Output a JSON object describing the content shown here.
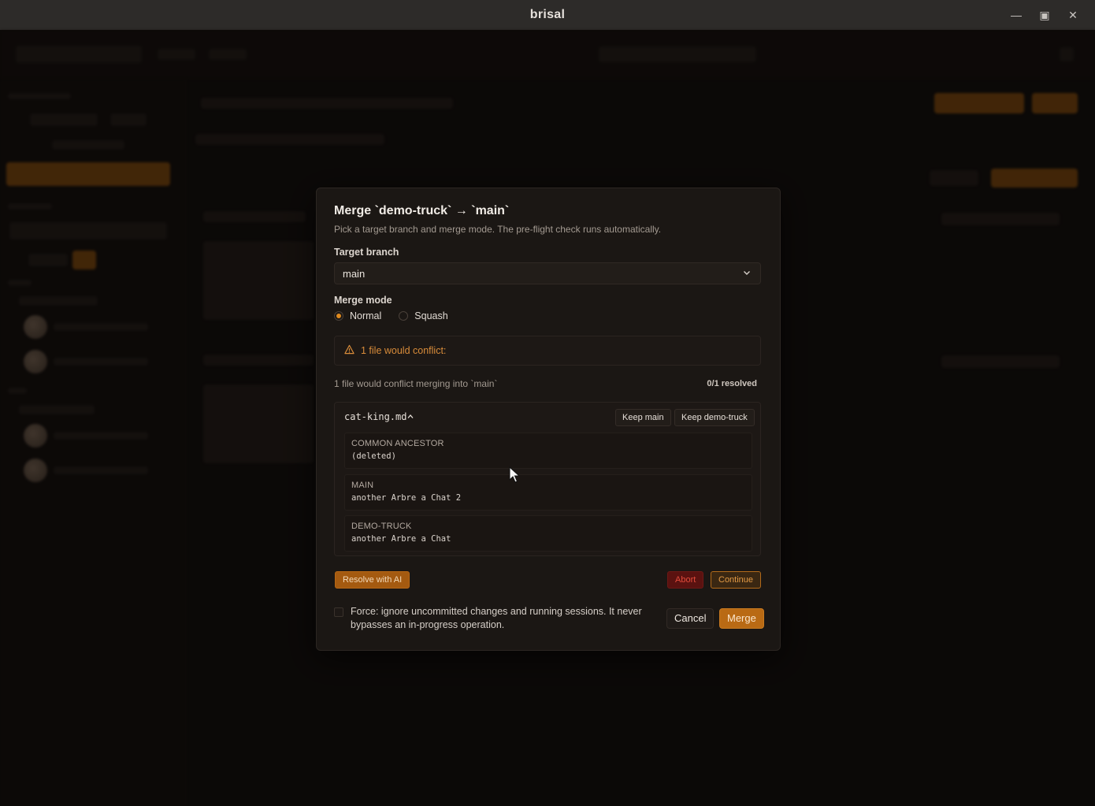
{
  "window": {
    "title": "brisal",
    "controls": [
      "minimize",
      "maximize",
      "close"
    ]
  },
  "colors": {
    "accent": "#e08a1e",
    "danger": "#e24b3b",
    "background": "#0b0908",
    "modal": "#1b1714"
  },
  "dialog": {
    "title": "Merge `demo-truck` → `main`",
    "subtitle": "Pick a target branch and merge mode. The pre-flight check runs automatically.",
    "target_branch_label": "Target branch",
    "target_branch_value": "main",
    "merge_mode_label": "Merge mode",
    "modes": [
      {
        "label": "Normal",
        "selected": true
      },
      {
        "label": "Squash",
        "selected": false
      }
    ],
    "warning": "1 file would conflict:",
    "conflict_summary": "1 file would conflict merging into `main`",
    "resolved_count": "0/1 resolved",
    "file": {
      "name": "cat-king.md",
      "keep_main_label": "Keep main",
      "keep_branch_label": "Keep demo-truck",
      "versions": [
        {
          "header": "COMMON ANCESTOR",
          "content": "(deleted)"
        },
        {
          "header": "MAIN",
          "content": "another Arbre a Chat 2"
        },
        {
          "header": "DEMO-TRUCK",
          "content": "another Arbre a Chat"
        }
      ]
    },
    "resolve_ai_label": "Resolve with AI",
    "abort_label": "Abort",
    "continue_label": "Continue",
    "force_text": "Force: ignore uncommitted changes and running sessions. It never bypasses an in-progress operation.",
    "cancel_label": "Cancel",
    "merge_label": "Merge"
  }
}
